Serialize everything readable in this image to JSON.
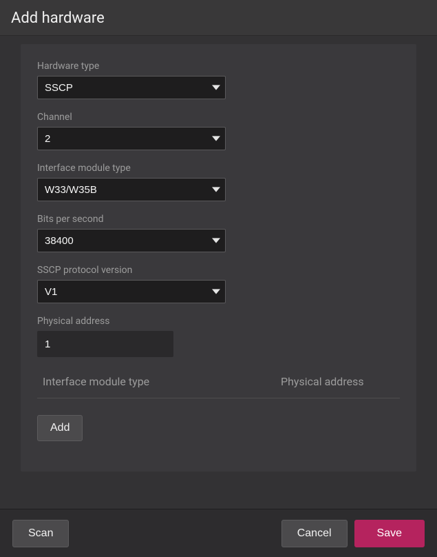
{
  "modal": {
    "title": "Add hardware"
  },
  "form": {
    "hardware_type": {
      "label": "Hardware type",
      "value": "SSCP"
    },
    "channel": {
      "label": "Channel",
      "value": "2"
    },
    "iface_module_type": {
      "label": "Interface module type",
      "value": "W33/W35B"
    },
    "bps": {
      "label": "Bits per second",
      "value": "38400"
    },
    "sscp_ver": {
      "label": "SSCP protocol version",
      "value": "V1"
    },
    "physical_address": {
      "label": "Physical address",
      "value": "1"
    }
  },
  "table": {
    "columns": {
      "c1": "Interface module type",
      "c2": "Physical address"
    }
  },
  "buttons": {
    "add": "Add",
    "scan": "Scan",
    "cancel": "Cancel",
    "save": "Save"
  }
}
